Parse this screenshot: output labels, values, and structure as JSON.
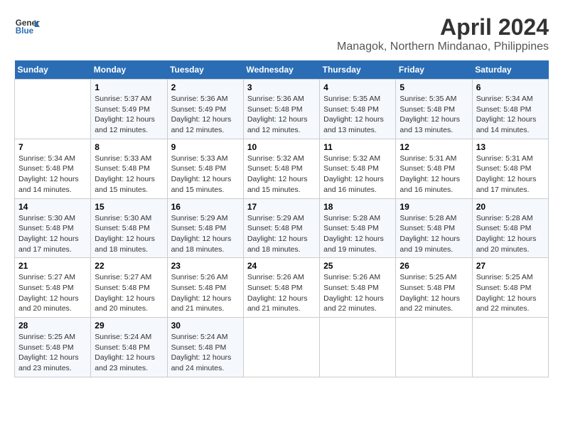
{
  "logo": {
    "line1": "General",
    "line2": "Blue"
  },
  "title": "April 2024",
  "subtitle": "Managok, Northern Mindanao, Philippines",
  "weekdays": [
    "Sunday",
    "Monday",
    "Tuesday",
    "Wednesday",
    "Thursday",
    "Friday",
    "Saturday"
  ],
  "weeks": [
    [
      {
        "day": "",
        "sunrise": "",
        "sunset": "",
        "daylight": ""
      },
      {
        "day": "1",
        "sunrise": "Sunrise: 5:37 AM",
        "sunset": "Sunset: 5:49 PM",
        "daylight": "Daylight: 12 hours and 12 minutes."
      },
      {
        "day": "2",
        "sunrise": "Sunrise: 5:36 AM",
        "sunset": "Sunset: 5:49 PM",
        "daylight": "Daylight: 12 hours and 12 minutes."
      },
      {
        "day": "3",
        "sunrise": "Sunrise: 5:36 AM",
        "sunset": "Sunset: 5:48 PM",
        "daylight": "Daylight: 12 hours and 12 minutes."
      },
      {
        "day": "4",
        "sunrise": "Sunrise: 5:35 AM",
        "sunset": "Sunset: 5:48 PM",
        "daylight": "Daylight: 12 hours and 13 minutes."
      },
      {
        "day": "5",
        "sunrise": "Sunrise: 5:35 AM",
        "sunset": "Sunset: 5:48 PM",
        "daylight": "Daylight: 12 hours and 13 minutes."
      },
      {
        "day": "6",
        "sunrise": "Sunrise: 5:34 AM",
        "sunset": "Sunset: 5:48 PM",
        "daylight": "Daylight: 12 hours and 14 minutes."
      }
    ],
    [
      {
        "day": "7",
        "sunrise": "Sunrise: 5:34 AM",
        "sunset": "Sunset: 5:48 PM",
        "daylight": "Daylight: 12 hours and 14 minutes."
      },
      {
        "day": "8",
        "sunrise": "Sunrise: 5:33 AM",
        "sunset": "Sunset: 5:48 PM",
        "daylight": "Daylight: 12 hours and 15 minutes."
      },
      {
        "day": "9",
        "sunrise": "Sunrise: 5:33 AM",
        "sunset": "Sunset: 5:48 PM",
        "daylight": "Daylight: 12 hours and 15 minutes."
      },
      {
        "day": "10",
        "sunrise": "Sunrise: 5:32 AM",
        "sunset": "Sunset: 5:48 PM",
        "daylight": "Daylight: 12 hours and 15 minutes."
      },
      {
        "day": "11",
        "sunrise": "Sunrise: 5:32 AM",
        "sunset": "Sunset: 5:48 PM",
        "daylight": "Daylight: 12 hours and 16 minutes."
      },
      {
        "day": "12",
        "sunrise": "Sunrise: 5:31 AM",
        "sunset": "Sunset: 5:48 PM",
        "daylight": "Daylight: 12 hours and 16 minutes."
      },
      {
        "day": "13",
        "sunrise": "Sunrise: 5:31 AM",
        "sunset": "Sunset: 5:48 PM",
        "daylight": "Daylight: 12 hours and 17 minutes."
      }
    ],
    [
      {
        "day": "14",
        "sunrise": "Sunrise: 5:30 AM",
        "sunset": "Sunset: 5:48 PM",
        "daylight": "Daylight: 12 hours and 17 minutes."
      },
      {
        "day": "15",
        "sunrise": "Sunrise: 5:30 AM",
        "sunset": "Sunset: 5:48 PM",
        "daylight": "Daylight: 12 hours and 18 minutes."
      },
      {
        "day": "16",
        "sunrise": "Sunrise: 5:29 AM",
        "sunset": "Sunset: 5:48 PM",
        "daylight": "Daylight: 12 hours and 18 minutes."
      },
      {
        "day": "17",
        "sunrise": "Sunrise: 5:29 AM",
        "sunset": "Sunset: 5:48 PM",
        "daylight": "Daylight: 12 hours and 18 minutes."
      },
      {
        "day": "18",
        "sunrise": "Sunrise: 5:28 AM",
        "sunset": "Sunset: 5:48 PM",
        "daylight": "Daylight: 12 hours and 19 minutes."
      },
      {
        "day": "19",
        "sunrise": "Sunrise: 5:28 AM",
        "sunset": "Sunset: 5:48 PM",
        "daylight": "Daylight: 12 hours and 19 minutes."
      },
      {
        "day": "20",
        "sunrise": "Sunrise: 5:28 AM",
        "sunset": "Sunset: 5:48 PM",
        "daylight": "Daylight: 12 hours and 20 minutes."
      }
    ],
    [
      {
        "day": "21",
        "sunrise": "Sunrise: 5:27 AM",
        "sunset": "Sunset: 5:48 PM",
        "daylight": "Daylight: 12 hours and 20 minutes."
      },
      {
        "day": "22",
        "sunrise": "Sunrise: 5:27 AM",
        "sunset": "Sunset: 5:48 PM",
        "daylight": "Daylight: 12 hours and 20 minutes."
      },
      {
        "day": "23",
        "sunrise": "Sunrise: 5:26 AM",
        "sunset": "Sunset: 5:48 PM",
        "daylight": "Daylight: 12 hours and 21 minutes."
      },
      {
        "day": "24",
        "sunrise": "Sunrise: 5:26 AM",
        "sunset": "Sunset: 5:48 PM",
        "daylight": "Daylight: 12 hours and 21 minutes."
      },
      {
        "day": "25",
        "sunrise": "Sunrise: 5:26 AM",
        "sunset": "Sunset: 5:48 PM",
        "daylight": "Daylight: 12 hours and 22 minutes."
      },
      {
        "day": "26",
        "sunrise": "Sunrise: 5:25 AM",
        "sunset": "Sunset: 5:48 PM",
        "daylight": "Daylight: 12 hours and 22 minutes."
      },
      {
        "day": "27",
        "sunrise": "Sunrise: 5:25 AM",
        "sunset": "Sunset: 5:48 PM",
        "daylight": "Daylight: 12 hours and 22 minutes."
      }
    ],
    [
      {
        "day": "28",
        "sunrise": "Sunrise: 5:25 AM",
        "sunset": "Sunset: 5:48 PM",
        "daylight": "Daylight: 12 hours and 23 minutes."
      },
      {
        "day": "29",
        "sunrise": "Sunrise: 5:24 AM",
        "sunset": "Sunset: 5:48 PM",
        "daylight": "Daylight: 12 hours and 23 minutes."
      },
      {
        "day": "30",
        "sunrise": "Sunrise: 5:24 AM",
        "sunset": "Sunset: 5:48 PM",
        "daylight": "Daylight: 12 hours and 24 minutes."
      },
      {
        "day": "",
        "sunrise": "",
        "sunset": "",
        "daylight": ""
      },
      {
        "day": "",
        "sunrise": "",
        "sunset": "",
        "daylight": ""
      },
      {
        "day": "",
        "sunrise": "",
        "sunset": "",
        "daylight": ""
      },
      {
        "day": "",
        "sunrise": "",
        "sunset": "",
        "daylight": ""
      }
    ]
  ]
}
